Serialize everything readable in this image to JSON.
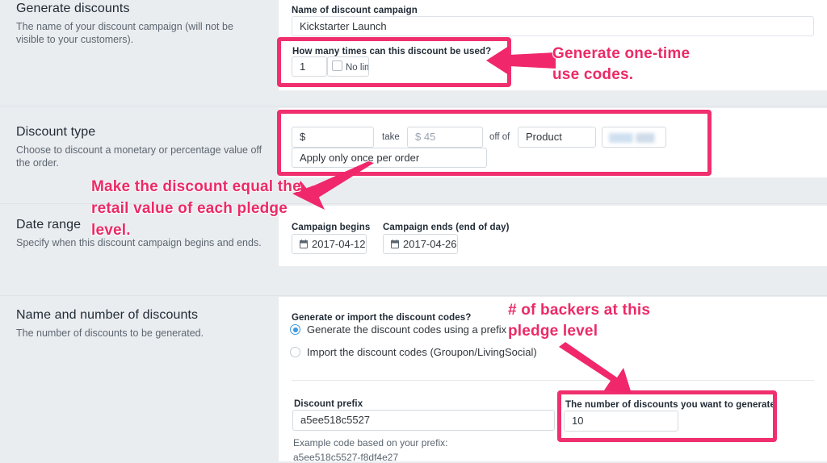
{
  "page": {
    "background_color": "#eaedf0",
    "accent_color": "#f02f6e",
    "panel_color": "#ffffff"
  },
  "sections": [
    {
      "id": "generate-discounts",
      "title": "Generate discounts",
      "description": "The name of your discount campaign (will not be visible to your customers)."
    },
    {
      "id": "discount-type",
      "title": "Discount type",
      "description": "Choose to discount a monetary or percentage value off the order."
    },
    {
      "id": "date-range",
      "title": "Date range",
      "description": "Specify when this discount campaign begins and ends."
    },
    {
      "id": "name-and-number",
      "title": "Name and number of discounts",
      "description": "The number of discounts to be generated."
    }
  ],
  "campaign_name": {
    "label": "Name of discount campaign",
    "value": "Kickstarter Launch"
  },
  "usage_limit": {
    "label": "How many times can this discount be used?",
    "value": "1",
    "no_limit_label": "No limit",
    "no_limit_checked": false
  },
  "discount_type": {
    "currency_value": "$",
    "take_label": "take",
    "amount_value": "$ 45",
    "off_of_label": "off of",
    "target_value": "Product",
    "target_detail_value": "",
    "apply_once_value": "Apply only once per order"
  },
  "date_range": {
    "begins_label": "Campaign begins",
    "begins_value": "2017-04-12",
    "ends_label": "Campaign ends (end of day)",
    "ends_value": "2017-04-26",
    "calendar_icon": "calendar-icon"
  },
  "codes": {
    "question_label": "Generate or import the discount codes?",
    "option_generate": "Generate the discount codes using a prefix",
    "option_import": "Import the discount codes (Groupon/LivingSocial)",
    "selected": "generate",
    "prefix_label": "Discount prefix",
    "prefix_value": "a5ee518c5527",
    "example_label": "Example code based on your prefix:",
    "example_value": "a5ee518c5527-f8df4e27",
    "count_label": "The number of discounts you want to generate",
    "count_value": "10"
  },
  "annotations": [
    {
      "id": "one-time-codes",
      "text": "Generate one-time\nuse codes.",
      "color": "#eb2a67"
    },
    {
      "id": "discount-equal-retail",
      "text": "Make the discount equal the\nretail value of each pledge\nlevel.",
      "color": "#eb2a67"
    },
    {
      "id": "backers-count",
      "text": "# of backers at this\npledge level",
      "color": "#eb2a67"
    }
  ]
}
